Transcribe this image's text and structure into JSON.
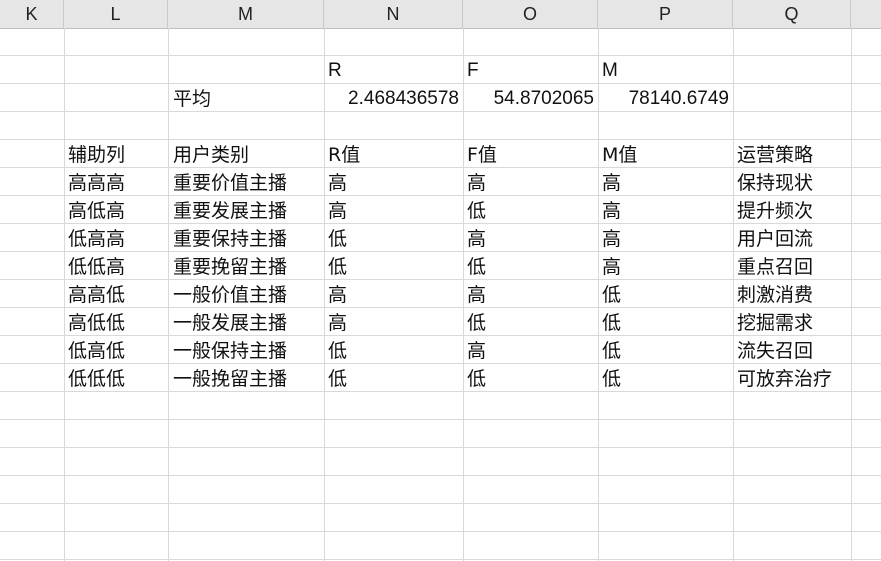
{
  "columns": [
    "K",
    "L",
    "M",
    "N",
    "O",
    "P",
    "Q"
  ],
  "summary": {
    "r_header": "R",
    "f_header": "F",
    "m_header": "M",
    "label": "平均",
    "r_value": "2.468436578",
    "f_value": "54.8702065",
    "m_value": "78140.6749"
  },
  "table": {
    "headers": [
      "辅助列",
      "用户类别",
      "R值",
      "F值",
      "M值",
      "运营策略"
    ],
    "rows": [
      [
        "高高高",
        "重要价值主播",
        "高",
        "高",
        "高",
        "保持现状"
      ],
      [
        "高低高",
        "重要发展主播",
        "高",
        "低",
        "高",
        "提升频次"
      ],
      [
        "低高高",
        "重要保持主播",
        "低",
        "高",
        "高",
        "用户回流"
      ],
      [
        "低低高",
        "重要挽留主播",
        "低",
        "低",
        "高",
        "重点召回"
      ],
      [
        "高高低",
        "一般价值主播",
        "高",
        "高",
        "低",
        "刺激消费"
      ],
      [
        "高低低",
        "一般发展主播",
        "高",
        "低",
        "低",
        "挖掘需求"
      ],
      [
        "低高低",
        "一般保持主播",
        "低",
        "高",
        "低",
        "流失召回"
      ],
      [
        "低低低",
        "一般挽留主播",
        "低",
        "低",
        "低",
        "可放弃治疗"
      ]
    ]
  }
}
